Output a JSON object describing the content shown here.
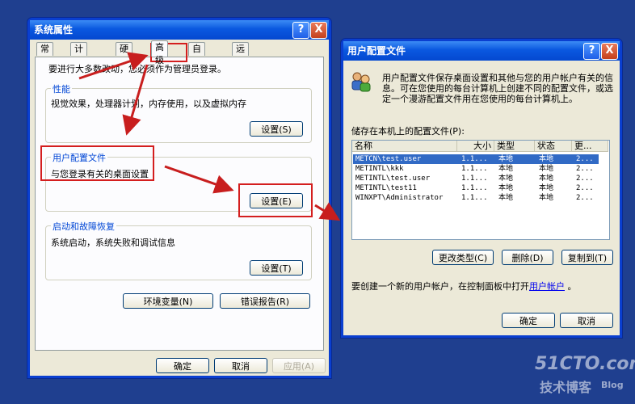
{
  "sys_window": {
    "title": "系统属性",
    "tabs": [
      "常规",
      "计算机名",
      "硬件",
      "高级",
      "自动更新",
      "远程"
    ],
    "admin_note": "要进行大多数改动，您必须作为管理员登录。",
    "perf": {
      "title": "性能",
      "desc": "视觉效果，处理器计划，内存使用，以及虚拟内存",
      "btn": "设置(S)"
    },
    "profile": {
      "title": "用户配置文件",
      "desc": "与您登录有关的桌面设置",
      "btn": "设置(E)"
    },
    "startup": {
      "title": "启动和故障恢复",
      "desc": "系统启动，系统失败和调试信息",
      "btn": "设置(T)"
    },
    "env_btn": "环境变量(N)",
    "err_btn": "错误报告(R)",
    "ok": "确定",
    "cancel": "取消",
    "apply": "应用(A)"
  },
  "profile_window": {
    "title": "用户配置文件",
    "intro": [
      "用户配置文件保存桌面设置和其他与您的用户帐户有关的信",
      "息。可在您使用的每台计算机上创建不同的配置文件，或选",
      "定一个漫游配置文件用在您使用的每台计算机上。"
    ],
    "list_label": "储存在本机上的配置文件(P):",
    "columns": [
      "名称",
      "大小",
      "类型",
      "状态",
      "更..."
    ],
    "rows": [
      [
        "METCN\\test.user",
        "1.1...",
        "本地",
        "本地",
        "2..."
      ],
      [
        "METINTL\\kkk",
        "1.1...",
        "本地",
        "本地",
        "2..."
      ],
      [
        "METINTL\\test.user",
        "1.1...",
        "本地",
        "本地",
        "2..."
      ],
      [
        "METINTL\\test11",
        "1.1...",
        "本地",
        "本地",
        "2..."
      ],
      [
        "WINXPT\\Administrator",
        "1.1...",
        "本地",
        "本地",
        "2..."
      ]
    ],
    "change_type": "更改类型(C)",
    "delete": "删除(D)",
    "copy_to": "复制到(T)",
    "footer_text": "要创建一个新的用户帐户，在控制面板中打开",
    "footer_link": "用户帐户",
    "footer_end": "。",
    "ok": "确定",
    "cancel": "取消"
  },
  "titlebar_buttons": {
    "help": "?",
    "close": "X"
  },
  "watermark": {
    "line1": "51CTO.com",
    "line2": "技术博客",
    "line3": "Blog"
  }
}
